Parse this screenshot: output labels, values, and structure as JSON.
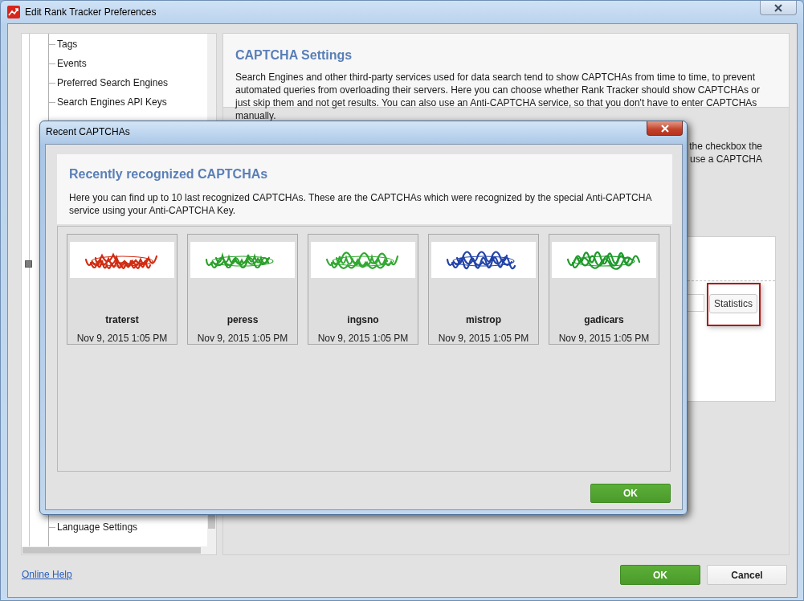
{
  "window": {
    "title": "Edit Rank Tracker Preferences"
  },
  "tree": {
    "items_top": [
      {
        "label": "Tags"
      },
      {
        "label": "Events"
      },
      {
        "label": "Preferred Search Engines"
      },
      {
        "label": "Search Engines API Keys"
      }
    ],
    "items_bottom": [
      {
        "label": "Language Settings"
      }
    ]
  },
  "panel": {
    "title": "CAPTCHA Settings",
    "description": "Search Engines and other third-party services used for data search tend to show CAPTCHAs from time to time, to prevent automated queries from overloading their servers. Here you can choose whether Rank Tracker should show CAPTCHAs or just skip them and not get results. You can also use an Anti-CAPTCHA service, so that you don't have to enter CAPTCHAs manually.",
    "fragments": [
      "the checkbox the",
      "use a CAPTCHA"
    ],
    "statistics_button": "Statistics"
  },
  "dialog": {
    "title": "Recent CAPTCHAs",
    "heading": "Recently recognized CAPTCHAs",
    "description": "Here you can find up to 10 last recognized CAPTCHAs. These are the CAPTCHAs which were recognized by the special Anti-CAPTCHA service using your Anti-CAPTCHA Key.",
    "captchas": [
      {
        "text": "traterst",
        "date": "Nov 9, 2015 1:05 PM",
        "color": "#d02c12",
        "kind": "picture"
      },
      {
        "text": "peress",
        "date": "Nov 9, 2015 1:05 PM",
        "color": "#2aa02a",
        "kind": "picture"
      },
      {
        "text": "ingsno",
        "date": "Nov 9, 2015 1:05 PM",
        "color": "#32a832",
        "kind": "picture"
      },
      {
        "text": "mistrop",
        "date": "Nov 9, 2015 1:05 PM",
        "color": "#2243a8",
        "kind": "picture"
      },
      {
        "text": "gadicars",
        "date": "Nov 9, 2015 1:05 PM",
        "color": "#1e9a2a",
        "kind": "picture"
      }
    ],
    "ok": "OK"
  },
  "footer": {
    "help_link": "Online Help",
    "ok": "OK",
    "cancel": "Cancel"
  }
}
